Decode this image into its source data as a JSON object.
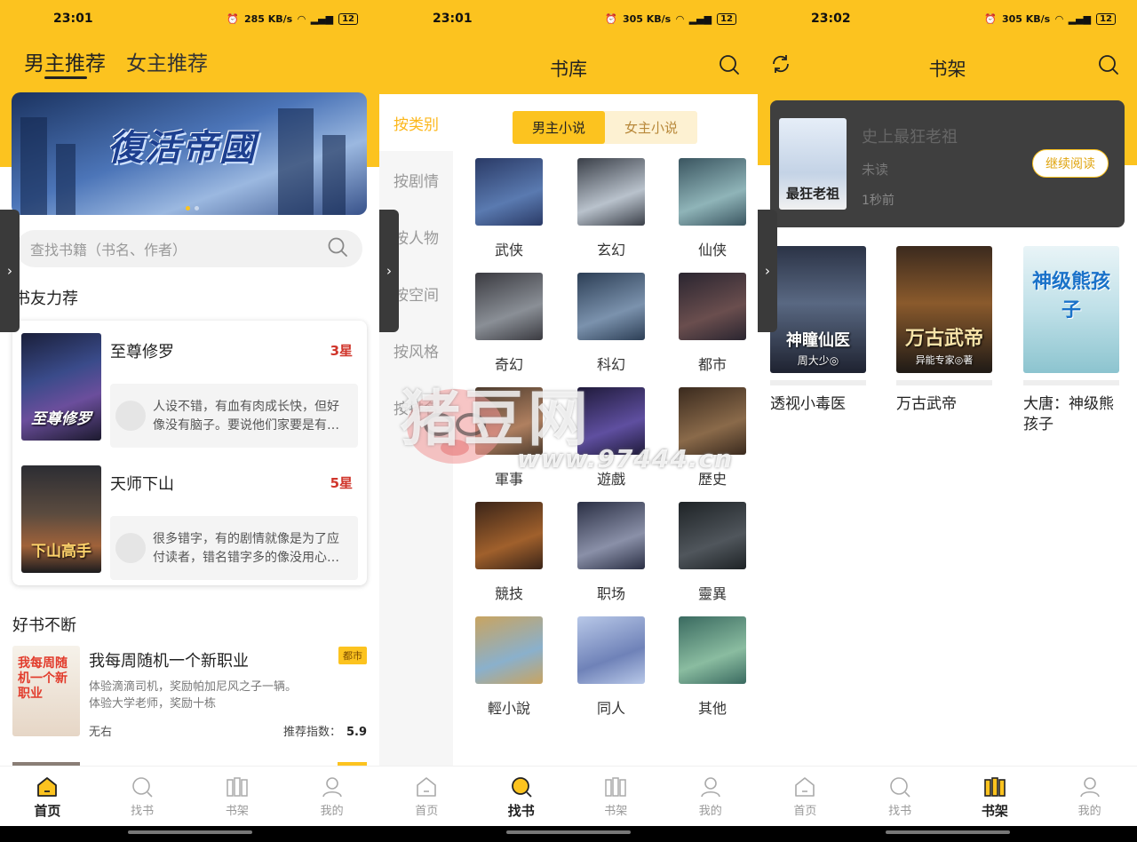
{
  "status": [
    {
      "time": "23:01",
      "speed": "285 KB/s",
      "battery": "12"
    },
    {
      "time": "23:01",
      "speed": "305 KB/s",
      "battery": "12"
    },
    {
      "time": "23:02",
      "speed": "305 KB/s",
      "battery": "12"
    }
  ],
  "home": {
    "tabs": [
      "男主推荐",
      "女主推荐"
    ],
    "banner_title": "復活帝國",
    "search_placeholder": "查找书籍（书名、作者）",
    "section_recommend": "书友力荐",
    "recommend": [
      {
        "name": "至尊修罗",
        "rating": "3星",
        "comment": "人设不错，有血有肉成长快，但好像没有脑子。要说他们家要是有一个…",
        "cover_text": "至尊修罗"
      },
      {
        "name": "天师下山",
        "rating": "5星",
        "comment": "很多错字，有的剧情就像是为了应付读者，错名错字多的像没用心一…",
        "cover_text": "下山高手"
      }
    ],
    "section_books": "好书不断",
    "book": {
      "name": "我每周随机一个新职业",
      "tag": "都市",
      "desc1": "体验滴滴司机，奖励帕加尼风之子一辆。",
      "desc2": "体验大学老师，奖励十栋",
      "author": "无右",
      "score_label": "推荐指数：",
      "score": "5.9",
      "cover_text": "我每周随机一个新职业"
    }
  },
  "library": {
    "title": "书库",
    "side": [
      "按类别",
      "按剧情",
      "按人物",
      "按空间",
      "按风格",
      "按排名"
    ],
    "gender_tabs": [
      "男主小说",
      "女主小说"
    ],
    "genres": [
      "武侠",
      "玄幻",
      "仙侠",
      "奇幻",
      "科幻",
      "都市",
      "軍事",
      "遊戲",
      "歷史",
      "競技",
      "职场",
      "靈異",
      "輕小說",
      "同人",
      "其他"
    ]
  },
  "shelf": {
    "title": "书架",
    "recent": {
      "name": "史上最狂老祖",
      "status": "未读",
      "time": "1秒前",
      "button": "继续阅读",
      "cover_text": "最狂老祖"
    },
    "books": [
      {
        "name": "透视小毒医",
        "cover_text": "神瞳仙医",
        "cover_sub": "周大少◎"
      },
      {
        "name": "万古武帝",
        "cover_text": "万古武帝",
        "cover_sub": "异能专家◎著"
      },
      {
        "name": "大唐：神级熊孩子",
        "cover_text": "神级熊孩子",
        "cover_sub": ""
      }
    ]
  },
  "bottom_nav": [
    "首页",
    "找书",
    "书架",
    "我的"
  ],
  "watermark": {
    "text": "猪豆网",
    "url": "www.97444.cn"
  },
  "colors": {
    "accent": "#fcc31f",
    "rating": "#d0352b",
    "side_active": "#fcb71b"
  }
}
